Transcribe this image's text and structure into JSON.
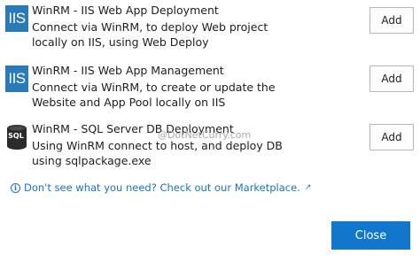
{
  "tasks": [
    {
      "icon": "iis-icon",
      "icon_text": "IIS",
      "title": "WinRM - IIS Web App Deployment",
      "description": "Connect via WinRM, to deploy Web project locally on IIS, using Web Deploy",
      "button": "Add"
    },
    {
      "icon": "iis-icon",
      "icon_text": "IIS",
      "title": "WinRM - IIS Web App Management",
      "description": "Connect via WinRM, to create or update the Website and App Pool locally on IIS",
      "button": "Add"
    },
    {
      "icon": "sql-database-icon",
      "icon_text": "SQL",
      "title": "WinRM - SQL Server DB Deployment",
      "description": "Using WinRM connect to host, and deploy DB using sqlpackage.exe",
      "button": "Add"
    }
  ],
  "marketplace": {
    "icon": "info-icon",
    "text": "Don't see what you need? Check out our Marketplace.",
    "external_icon": "external-link-icon"
  },
  "watermark": "@DotNetCurry.com",
  "footer": {
    "close_label": "Close"
  },
  "colors": {
    "accent": "#1177cc",
    "iis_icon_bg": "#2a7ab8",
    "link": "#1a73c8"
  }
}
